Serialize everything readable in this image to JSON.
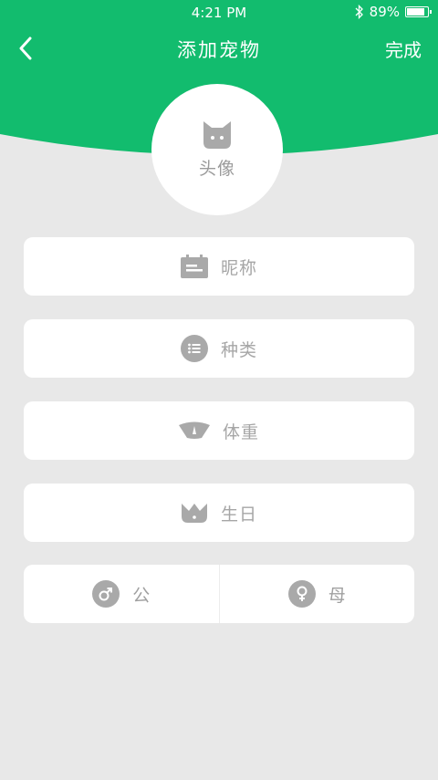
{
  "status_bar": {
    "time": "4:21 PM",
    "battery_percent": "89%",
    "battery_level": 0.89
  },
  "nav": {
    "title": "添加宠物",
    "done_label": "完成"
  },
  "avatar": {
    "label": "头像"
  },
  "fields": {
    "nickname": "昵称",
    "species": "种类",
    "weight": "体重",
    "birthday": "生日"
  },
  "gender": {
    "male": "公",
    "female": "母"
  },
  "colors": {
    "brand": "#12bc6e",
    "background": "#e8e8e8",
    "icon_gray": "#a9a9a9"
  }
}
